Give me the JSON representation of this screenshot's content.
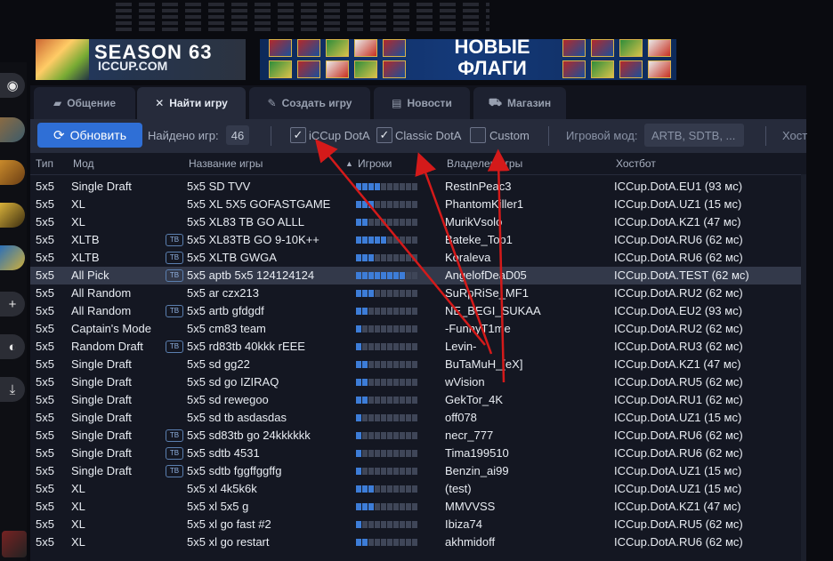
{
  "banners": {
    "season_title": "SEASON 63",
    "season_site": "ICCUP.COM",
    "flags_line1": "НОВЫЕ",
    "flags_line2": "ФЛАГИ"
  },
  "tabs": [
    {
      "label": "Общение",
      "icon": "chat-icon"
    },
    {
      "label": "Найти игру",
      "icon": "swords-icon"
    },
    {
      "label": "Создать игру",
      "icon": "quill-icon"
    },
    {
      "label": "Новости",
      "icon": "news-icon"
    },
    {
      "label": "Магазин",
      "icon": "cart-icon"
    }
  ],
  "toolbar": {
    "refresh_label": "Обновить",
    "found_label": "Найдено игр:",
    "found_count": "46",
    "filter_iccup": "iCCup DotA",
    "filter_classic": "Classic DotA",
    "filter_custom": "Custom",
    "mode_label": "Игровой мод:",
    "mode_value": "ARTB, SDTB, ...",
    "host_label": "Хост"
  },
  "columns": {
    "type": "Тип",
    "mode": "Мод",
    "name": "Название игры",
    "players": "Игроки",
    "owner": "Владелец игры",
    "host": "Хостбот"
  },
  "badge": "ТВ",
  "rows": [
    {
      "type": "5x5",
      "mode": "Single Draft",
      "tb": false,
      "name": "5x5 SD TVV",
      "players": 4,
      "owner": "RestInPeac3",
      "host": "ICCup.DotA.EU1 (93 мс)"
    },
    {
      "type": "5x5",
      "mode": "XL",
      "tb": false,
      "name": "5x5 XL 5X5 GOFASTGAME",
      "players": 3,
      "owner": "PhantomKiller1",
      "host": "ICCup.DotA.UZ1 (15 мс)"
    },
    {
      "type": "5x5",
      "mode": "XL",
      "tb": false,
      "name": "5x5 XL83 TB GO ALLL",
      "players": 2,
      "owner": "MurikVsolo",
      "host": "ICCup.DotA.KZ1 (47 мс)"
    },
    {
      "type": "5x5",
      "mode": "XLTB",
      "tb": true,
      "name": "5x5 XL83TB GO 9-10K++",
      "players": 5,
      "owner": "Bateke_Top1",
      "host": "ICCup.DotA.RU6 (62 мс)"
    },
    {
      "type": "5x5",
      "mode": "XLTB",
      "tb": true,
      "name": "5x5 XLTB GWGA",
      "players": 3,
      "owner": "Koraleva",
      "host": "ICCup.DotA.RU6 (62 мс)"
    },
    {
      "type": "5x5",
      "mode": "All Pick",
      "tb": true,
      "name": "5x5 aptb 5x5 124124124",
      "players": 8,
      "owner": "AngelofDeaD05",
      "host": "ICCup.DotA.TEST (62 мс)"
    },
    {
      "type": "5x5",
      "mode": "All Random",
      "tb": false,
      "name": "5x5 ar czx213",
      "players": 3,
      "owner": "SuRpRiSe_MF1",
      "host": "ICCup.DotA.RU2 (62 мс)"
    },
    {
      "type": "5x5",
      "mode": "All Random",
      "tb": true,
      "name": "5x5 artb gfdgdf",
      "players": 2,
      "owner": "NE_BEGI_SUKAA",
      "host": "ICCup.DotA.EU2 (93 мс)"
    },
    {
      "type": "5x5",
      "mode": "Captain's Mode",
      "tb": false,
      "name": "5x5 cm83 team",
      "players": 1,
      "owner": "-FunnyT1me",
      "host": "ICCup.DotA.RU2 (62 мс)"
    },
    {
      "type": "5x5",
      "mode": "Random Draft",
      "tb": true,
      "name": "5x5 rd83tb 40kkk rEEE",
      "players": 1,
      "owner": "Levin-",
      "host": "ICCup.DotA.RU3 (62 мс)"
    },
    {
      "type": "5x5",
      "mode": "Single Draft",
      "tb": false,
      "name": "5x5 sd gg22",
      "players": 2,
      "owner": "BuTaMuH_[eX]",
      "host": "ICCup.DotA.KZ1 (47 мс)"
    },
    {
      "type": "5x5",
      "mode": "Single Draft",
      "tb": false,
      "name": "5x5 sd go IZIRAQ",
      "players": 2,
      "owner": "wVision",
      "host": "ICCup.DotA.RU5 (62 мс)"
    },
    {
      "type": "5x5",
      "mode": "Single Draft",
      "tb": false,
      "name": "5x5 sd rewegoo",
      "players": 2,
      "owner": "GekTor_4K",
      "host": "ICCup.DotA.RU1 (62 мс)"
    },
    {
      "type": "5x5",
      "mode": "Single Draft",
      "tb": false,
      "name": "5x5 sd tb asdasdas",
      "players": 1,
      "owner": "off078",
      "host": "ICCup.DotA.UZ1 (15 мс)"
    },
    {
      "type": "5x5",
      "mode": "Single Draft",
      "tb": true,
      "name": "5x5 sd83tb go 24kkkkkk",
      "players": 1,
      "owner": "necr_777",
      "host": "ICCup.DotA.RU6 (62 мс)"
    },
    {
      "type": "5x5",
      "mode": "Single Draft",
      "tb": true,
      "name": "5x5 sdtb 4531",
      "players": 1,
      "owner": "Tima199510",
      "host": "ICCup.DotA.RU6 (62 мс)"
    },
    {
      "type": "5x5",
      "mode": "Single Draft",
      "tb": true,
      "name": "5x5 sdtb fggffggffg",
      "players": 1,
      "owner": "Benzin_ai99",
      "host": "ICCup.DotA.UZ1 (15 мс)"
    },
    {
      "type": "5x5",
      "mode": "XL",
      "tb": false,
      "name": "5x5 xl 4k5k6k",
      "players": 3,
      "owner": "(test)",
      "host": "ICCup.DotA.UZ1 (15 мс)"
    },
    {
      "type": "5x5",
      "mode": "XL",
      "tb": false,
      "name": "5x5 xl 5x5 g",
      "players": 3,
      "owner": "MMVVSS",
      "host": "ICCup.DotA.KZ1 (47 мс)"
    },
    {
      "type": "5x5",
      "mode": "XL",
      "tb": false,
      "name": "5x5 xl go fast #2",
      "players": 1,
      "owner": "Ibiza74",
      "host": "ICCup.DotA.RU5 (62 мс)"
    },
    {
      "type": "5x5",
      "mode": "XL",
      "tb": false,
      "name": "5x5 xl go restart",
      "players": 2,
      "owner": "akhmidoff",
      "host": "ICCup.DotA.RU6 (62 мс)"
    }
  ],
  "colors": {
    "accent": "#2f6fd6",
    "annotation_arrow": "#d41a1a",
    "selected_row": "#33394a"
  }
}
